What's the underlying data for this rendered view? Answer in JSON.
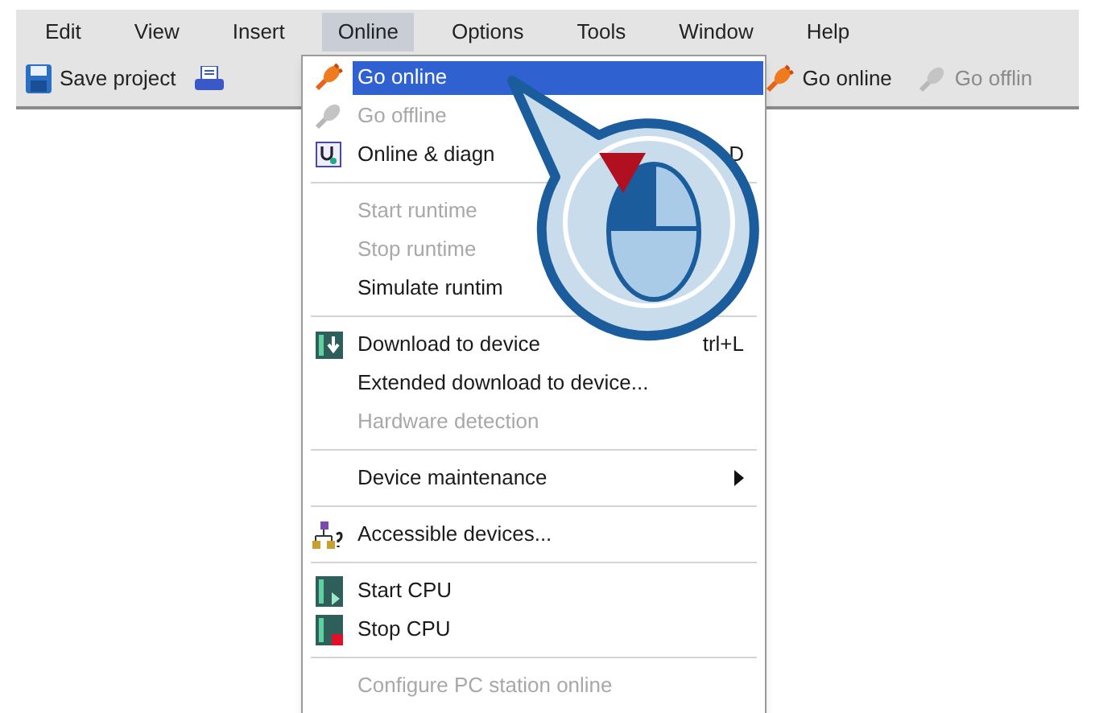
{
  "menu_bar": [
    {
      "label": "Edit",
      "selected": false
    },
    {
      "label": "View",
      "selected": false
    },
    {
      "label": "Insert",
      "selected": false
    },
    {
      "label": "Online",
      "selected": true
    },
    {
      "label": "Options",
      "selected": false
    },
    {
      "label": "Tools",
      "selected": false
    },
    {
      "label": "Window",
      "selected": false
    },
    {
      "label": "Help",
      "selected": false
    }
  ],
  "toolbar": [
    {
      "label": "Save project",
      "disabled": false
    },
    {
      "label": "Go online",
      "disabled": false
    },
    {
      "label": "Go offlin",
      "disabled": true
    }
  ],
  "online_menu": [
    {
      "kind": "item",
      "label": "Go online",
      "selected": true,
      "disabled": false
    },
    {
      "kind": "item",
      "label": "Go offline",
      "selected": false,
      "disabled": true
    },
    {
      "kind": "item",
      "label": "Online & diagn",
      "shortcut": "D",
      "selected": false,
      "disabled": false
    },
    {
      "kind": "separator"
    },
    {
      "kind": "item",
      "label": "Start runtime",
      "selected": false,
      "disabled": true
    },
    {
      "kind": "item",
      "label": "Stop runtime",
      "selected": false,
      "disabled": true
    },
    {
      "kind": "item",
      "label": "Simulate runtim",
      "selected": false,
      "disabled": false
    },
    {
      "kind": "separator"
    },
    {
      "kind": "item",
      "label": "Download to device",
      "shortcut": "trl+L",
      "selected": false,
      "disabled": false
    },
    {
      "kind": "item",
      "label": "Extended download to device...",
      "selected": false,
      "disabled": false
    },
    {
      "kind": "item",
      "label": "Hardware detection",
      "selected": false,
      "disabled": true
    },
    {
      "kind": "separator"
    },
    {
      "kind": "submenu",
      "label": "Device maintenance",
      "selected": false,
      "disabled": false
    },
    {
      "kind": "separator"
    },
    {
      "kind": "item",
      "label": "Accessible devices...",
      "selected": false,
      "disabled": false
    },
    {
      "kind": "separator"
    },
    {
      "kind": "item",
      "label": "Start CPU",
      "selected": false,
      "disabled": false
    },
    {
      "kind": "item",
      "label": "Stop CPU",
      "selected": false,
      "disabled": false
    },
    {
      "kind": "separator"
    },
    {
      "kind": "item",
      "label": "Configure PC station online",
      "selected": false,
      "disabled": true
    }
  ]
}
